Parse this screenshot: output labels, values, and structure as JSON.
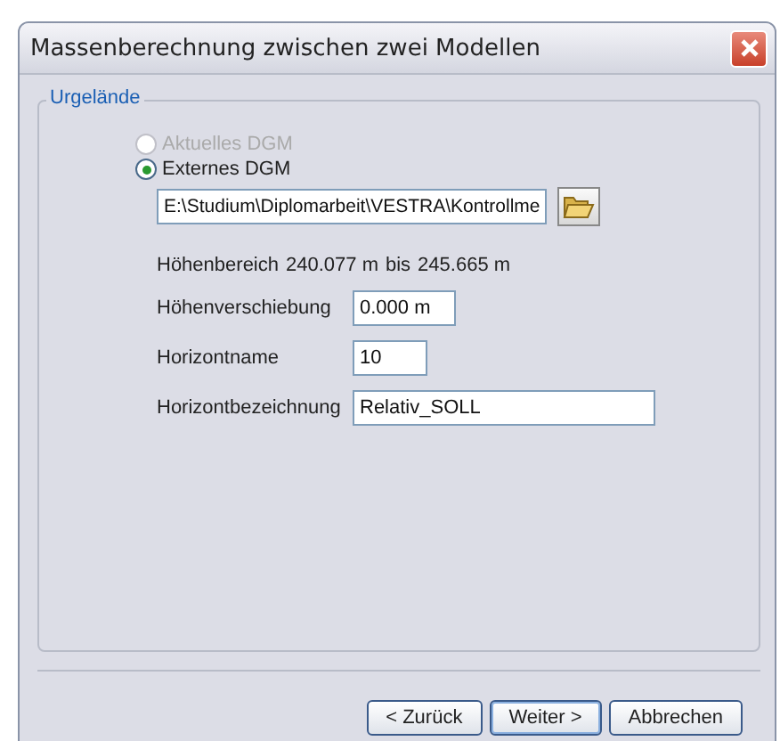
{
  "window": {
    "title": "Massenberechnung zwischen zwei Modellen"
  },
  "group": {
    "title": "Urgelände",
    "options": [
      {
        "label": "Aktuelles DGM",
        "selected": false,
        "disabled": true
      },
      {
        "label": "Externes DGM",
        "selected": true,
        "disabled": false
      }
    ],
    "path": {
      "value": "E:\\Studium\\Diplomarbeit\\VESTRA\\Kontrollme"
    },
    "range": {
      "label": "Höhenbereich",
      "from": "240.077 m",
      "sep": "bis",
      "to": "245.665 m"
    },
    "fields": [
      {
        "label": "Höhenverschiebung",
        "value": "0.000 m",
        "kind": "short"
      },
      {
        "label": "Horizontname",
        "value": "10",
        "kind": "tiny"
      },
      {
        "label": "Horizontbezeichnung",
        "value": "Relativ_SOLL",
        "kind": "long"
      }
    ]
  },
  "buttons": [
    {
      "label": "< Zurück",
      "selected": false
    },
    {
      "label": "Weiter >",
      "selected": true
    },
    {
      "label": "Abbrechen",
      "selected": false
    }
  ]
}
